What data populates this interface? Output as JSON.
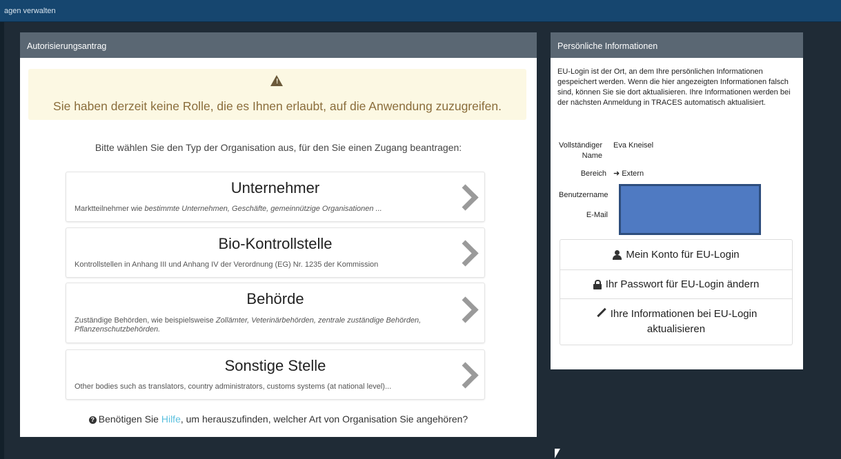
{
  "topbar": {
    "title": "agen verwalten"
  },
  "auth_panel": {
    "header": "Autorisierungsantrag",
    "alert_message": "Sie haben derzeit keine Rolle, die es Ihnen erlaubt, auf die Anwendung zuzugreifen.",
    "prompt": "Bitte wählen Sie den Typ der Organisation aus, für den Sie einen Zugang beantragen:",
    "options": [
      {
        "title": "Unternehmer",
        "desc_prefix": "Marktteilnehmer wie ",
        "desc_italic": "bestimmte Unternehmen, Geschäfte, gemeinnützige Organisationen ..."
      },
      {
        "title": "Bio-Kontrollstelle",
        "desc": "Kontrollstellen in Anhang III und Anhang IV der Verordnung (EG) Nr. 1235 der Kommission"
      },
      {
        "title": "Behörde",
        "desc_prefix": "Zuständige Behörden, wie beispielsweise ",
        "desc_italic": "Zollämter, Veterinärbehörden, zentrale zuständige Behörden, Pflanzenschutzbehörden."
      },
      {
        "title": "Sonstige Stelle",
        "desc": "Other bodies such as translators, country administrators, customs systems (at national level)..."
      }
    ],
    "help_prefix": "Benötigen Sie ",
    "help_link": "Hilfe",
    "help_suffix": ", um herauszufinden, welcher Art von Organisation Sie angehören?"
  },
  "info_panel": {
    "header": "Persönliche Informationen",
    "intro": "EU-Login ist der Ort, an dem Ihre persönlichen Informationen gespeichert werden. Wenn die hier angezeigten Informationen falsch sind, können Sie sie dort aktualisieren. Ihre Informationen werden bei der nächsten Anmeldung in TRACES automatisch aktualisiert.",
    "full_name_label_1": "Vollständiger",
    "full_name_label_2": "Name",
    "full_name_value": "Eva Kneisel",
    "area_label": "Bereich",
    "area_value": "Extern",
    "username_label": "Benutzername",
    "email_label": "E-Mail",
    "buttons": {
      "account": "Mein Konto für EU-Login",
      "password": "Ihr Passwort für EU-Login ändern",
      "update": "Ihre Informationen bei EU-Login aktualisieren"
    }
  },
  "icons": [
    "warning-icon",
    "chevron-right-icon",
    "question-circle-icon",
    "sign-out-icon",
    "user-icon",
    "lock-icon",
    "pencil-icon"
  ]
}
